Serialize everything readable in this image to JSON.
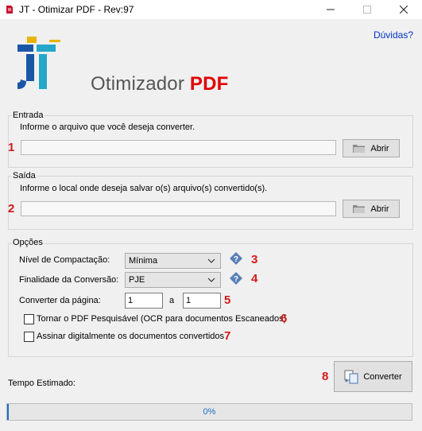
{
  "window": {
    "title": "JT - Otimizar PDF - Rev:97",
    "minimize_icon": "minimize-icon",
    "maximize_icon": "maximize-icon",
    "close_icon": "close-icon"
  },
  "header": {
    "help_link": "Dúvidas?",
    "brand_text": "Otimizador",
    "brand_highlight": "PDF",
    "brand_highlight_color": "#e00000"
  },
  "entrada": {
    "legend": "Entrada",
    "hint": "Informe o arquivo que você deseja converter.",
    "marker": "1",
    "path_value": "",
    "browse_label": "Abrir"
  },
  "saida": {
    "legend": "Saída",
    "hint": "Informe o local onde deseja salvar o(s) arquivo(s) convertido(s).",
    "marker": "2",
    "path_value": "",
    "browse_label": "Abrir"
  },
  "opcoes": {
    "legend": "Opções",
    "compactacao_label": "Nível de Compactação:",
    "compactacao_value": "Mínima",
    "compactacao_marker": "3",
    "finalidade_label": "Finalidade da Conversão:",
    "finalidade_value": "PJE",
    "finalidade_marker": "4",
    "pagina_label": "Converter da página:",
    "pagina_from": "1",
    "pagina_sep": "a",
    "pagina_to": "1",
    "pagina_marker": "5",
    "ocr_label": "Tornar o PDF Pesquisável (OCR para documentos Escaneados)",
    "ocr_checked": false,
    "ocr_marker": "6",
    "assinar_label": "Assinar digitalmente os documentos convertidos",
    "assinar_checked": false,
    "assinar_marker": "7"
  },
  "footer": {
    "tempo_label": "Tempo Estimado:",
    "convert_marker": "8",
    "convert_label": "Converter",
    "progress_text": "0%",
    "progress_value": 0
  },
  "colors": {
    "marker_red": "#d11a1a",
    "link_blue": "#0033cc",
    "progress_blue": "#1a6fc4"
  }
}
